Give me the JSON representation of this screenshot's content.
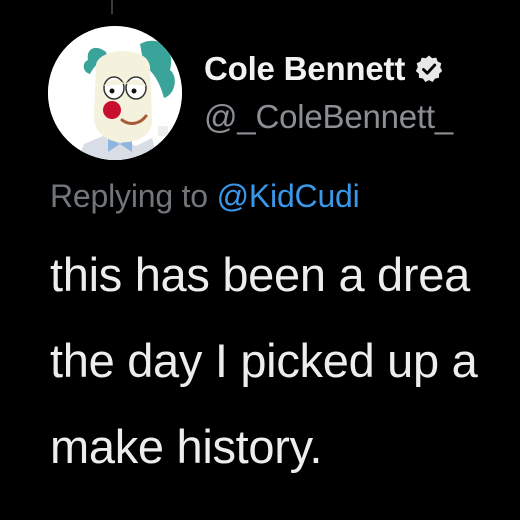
{
  "user": {
    "display_name": "Cole Bennett",
    "handle": "@_ColeBennett_",
    "verified_icon": "verified-badge-icon",
    "avatar_icon": "clown-avatar"
  },
  "reply": {
    "prefix": "Replying to",
    "mention": "@KidCudi"
  },
  "tweet": {
    "lines": [
      "this has been a drea",
      "the day I picked up a",
      "make history."
    ]
  },
  "colors": {
    "background": "#000000",
    "text_primary": "#ededed",
    "text_secondary": "#71767b",
    "link": "#3a97e8"
  }
}
